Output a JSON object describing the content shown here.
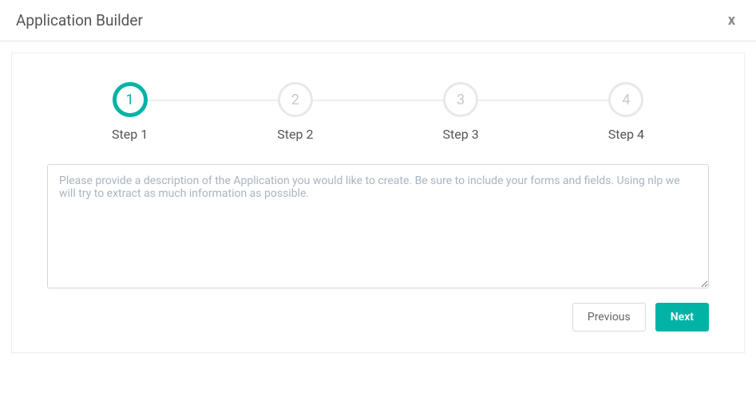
{
  "header": {
    "title": "Application Builder",
    "close": "x"
  },
  "stepper": {
    "steps": [
      {
        "number": "1",
        "label": "Step 1",
        "active": true
      },
      {
        "number": "2",
        "label": "Step 2",
        "active": false
      },
      {
        "number": "3",
        "label": "Step 3",
        "active": false
      },
      {
        "number": "4",
        "label": "Step 4",
        "active": false
      }
    ]
  },
  "form": {
    "description_placeholder": "Please provide a description of the Application you would like to create. Be sure to include your forms and fields. Using nlp we will try to extract as much information as possible.",
    "description_value": ""
  },
  "buttons": {
    "previous": "Previous",
    "next": "Next"
  },
  "colors": {
    "accent": "#00b3a4",
    "border": "#e6e6e6",
    "muted": "#c9c9c9"
  }
}
